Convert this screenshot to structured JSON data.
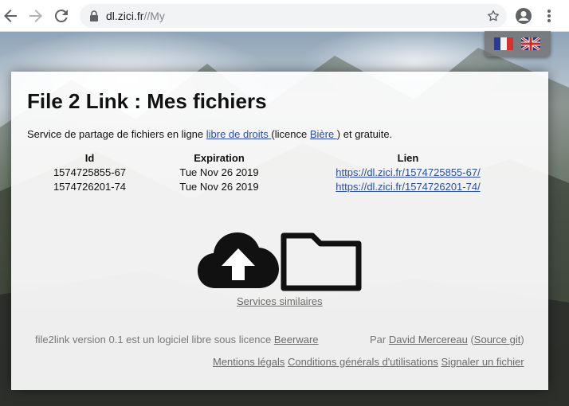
{
  "browser": {
    "url_host": "dl.zici.fr",
    "url_path": "//My"
  },
  "language_switch": {
    "icons": [
      "flag-fr-icon",
      "flag-en-icon"
    ]
  },
  "page": {
    "title": "File 2 Link : Mes fichiers",
    "intro": {
      "prefix": "Service de partage de fichiers en ligne ",
      "free_link": "libre de droits ",
      "middle": "(licence ",
      "license_link": "Bière ",
      "suffix": ") et gratuite."
    },
    "table": {
      "headers": {
        "id": "Id",
        "expiration": "Expiration",
        "link": "Lien"
      },
      "rows": [
        {
          "id": "1574725855-67",
          "expiration": "Tue Nov 26 2019",
          "link": "https://dl.zici.fr/1574725855-67/"
        },
        {
          "id": "1574726201-74",
          "expiration": "Tue Nov 26 2019",
          "link": "https://dl.zici.fr/1574726201-74/"
        }
      ]
    },
    "similar_services": "Services similaires",
    "footer": {
      "left_text": "file2link version 0.1 est un logiciel libre sous licence ",
      "beerware": "Beerware",
      "by": "Par ",
      "author": "David Mercereau",
      "open_paren": " (",
      "source": "Source git",
      "close_paren": ")",
      "links": {
        "legal": "Mentions légals",
        "terms": "Conditions générals d'utilisations",
        "report": "Signaler un fichier"
      }
    }
  },
  "colors": {
    "link": "#2b4f9e",
    "muted": "#777777",
    "title": "#111111"
  }
}
